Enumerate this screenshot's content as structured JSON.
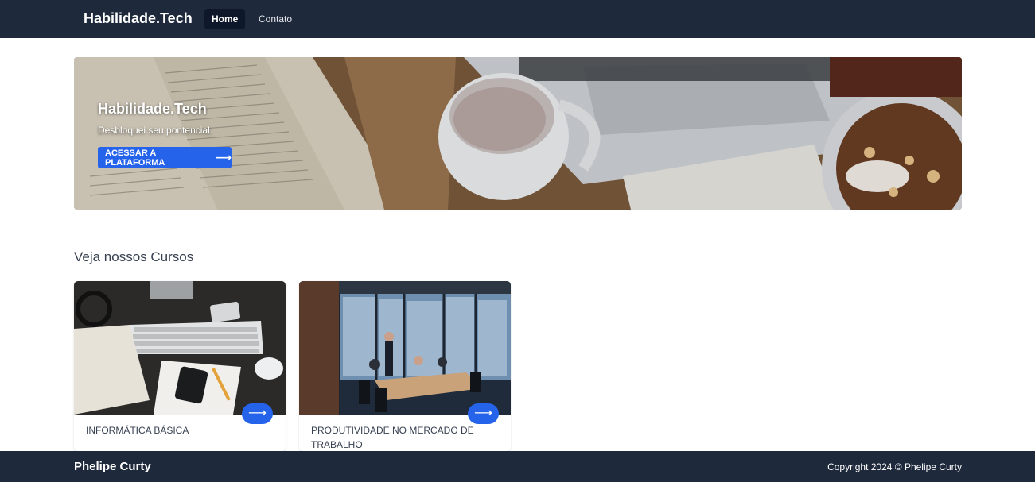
{
  "nav": {
    "brand": "Habilidade.Tech",
    "links": [
      {
        "label": "Home",
        "active": true
      },
      {
        "label": "Contato",
        "active": false
      }
    ]
  },
  "hero": {
    "title": "Habilidade.Tech",
    "subtitle": "Desbloquei seu pontencial.",
    "button_label": "ACESSAR A PLATAFORMA",
    "button_icon": "arrow-right-icon"
  },
  "courses": {
    "heading": "Veja nossos Cursos",
    "items": [
      {
        "title": "INFORMÁTICA BÁSICA",
        "icon": "arrow-right-icon"
      },
      {
        "title": "PRODUTIVIDADE NO MERCADO DE TRABALHO",
        "icon": "arrow-right-icon"
      }
    ]
  },
  "footer": {
    "name": "Phelipe Curty",
    "copyright": "Copyright 2024 © Phelipe Curty"
  },
  "colors": {
    "nav_bg": "#1e293b",
    "accent": "#2563eb"
  }
}
